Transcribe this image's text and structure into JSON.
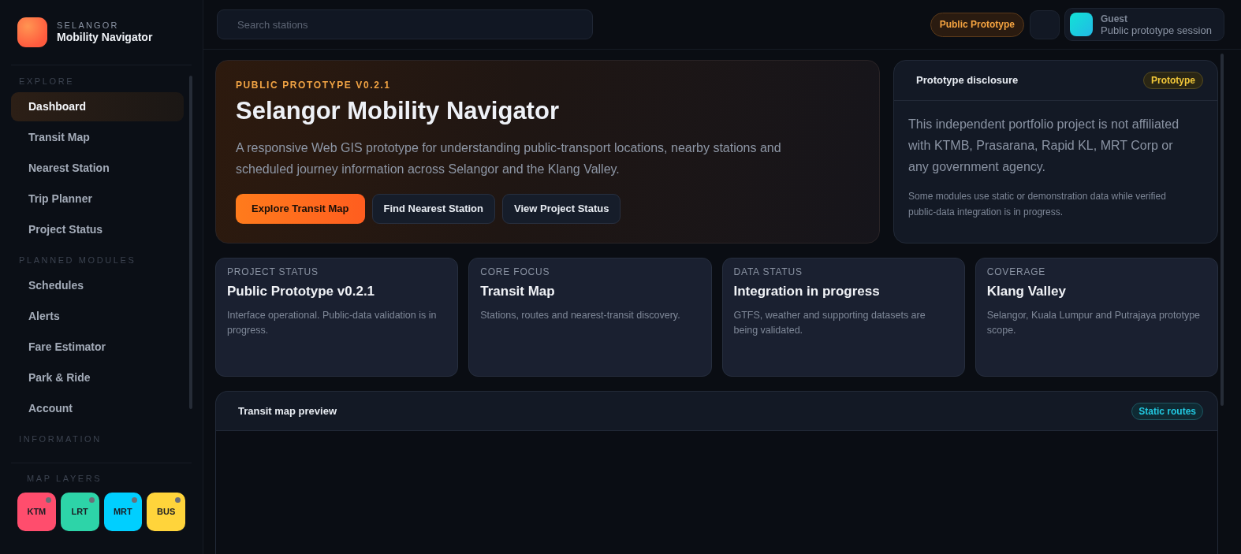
{
  "sidebar": {
    "brand": {
      "eyebrow": "SELANGOR",
      "title": "Mobility Navigator"
    },
    "sections": [
      {
        "heading": "EXPLORE",
        "items": [
          {
            "label": "Dashboard",
            "selected": true
          },
          {
            "label": "Transit Map",
            "selected": false
          },
          {
            "label": "Nearest Station",
            "selected": false
          },
          {
            "label": "Trip Planner",
            "selected": false
          },
          {
            "label": "Project Status",
            "selected": false
          }
        ]
      },
      {
        "heading": "PLANNED MODULES",
        "items": [
          {
            "label": "Schedules",
            "selected": false
          },
          {
            "label": "Alerts",
            "selected": false
          },
          {
            "label": "Fare Estimator",
            "selected": false
          },
          {
            "label": "Park & Ride",
            "selected": false
          },
          {
            "label": "Account",
            "selected": false
          }
        ]
      },
      {
        "heading": "INFORMATION"
      }
    ],
    "map_layers": {
      "heading": "MAP LAYERS",
      "layers": [
        {
          "label": "KTM",
          "color": "#ff4d6d"
        },
        {
          "label": "LRT",
          "color": "#2dd4a8"
        },
        {
          "label": "MRT",
          "color": "#00cfff"
        },
        {
          "label": "BUS",
          "color": "#ffd43b"
        }
      ]
    }
  },
  "topbar": {
    "search": {
      "placeholder": "Search stations"
    },
    "status_badge": "Public Prototype",
    "user": {
      "name": "Guest",
      "session": "Public prototype session"
    }
  },
  "hero": {
    "eyebrow": "PUBLIC PROTOTYPE V0.2.1",
    "title": "Selangor Mobility Navigator",
    "description": "A responsive Web GIS prototype for understanding public-transport locations, nearby stations and scheduled journey information across Selangor and the Klang Valley.",
    "buttons": [
      {
        "label": "Explore Transit Map",
        "kind": "primary"
      },
      {
        "label": "Find Nearest Station",
        "kind": "secondary"
      },
      {
        "label": "View Project Status",
        "kind": "secondary"
      }
    ]
  },
  "disclosure": {
    "title": "Prototype disclosure",
    "badge": "Prototype",
    "body": "This independent portfolio project is not affiliated with KTMB, Prasarana, Rapid KL, MRT Corp or any government agency.",
    "note": "Some modules use static or demonstration data while verified public-data integration is in progress."
  },
  "stats": [
    {
      "label": "PROJECT STATUS",
      "value": "Public Prototype v0.2.1",
      "description": "Interface operational. Public-data validation is in progress."
    },
    {
      "label": "CORE FOCUS",
      "value": "Transit Map",
      "description": "Stations, routes and nearest-transit discovery."
    },
    {
      "label": "DATA STATUS",
      "value": "Integration in progress",
      "description": "GTFS, weather and supporting datasets are being validated."
    },
    {
      "label": "COVERAGE",
      "value": "Klang Valley",
      "description": "Selangor, Kuala Lumpur and Putrajaya prototype scope."
    }
  ],
  "map_preview": {
    "title": "Transit map preview",
    "badge": "Static routes"
  }
}
